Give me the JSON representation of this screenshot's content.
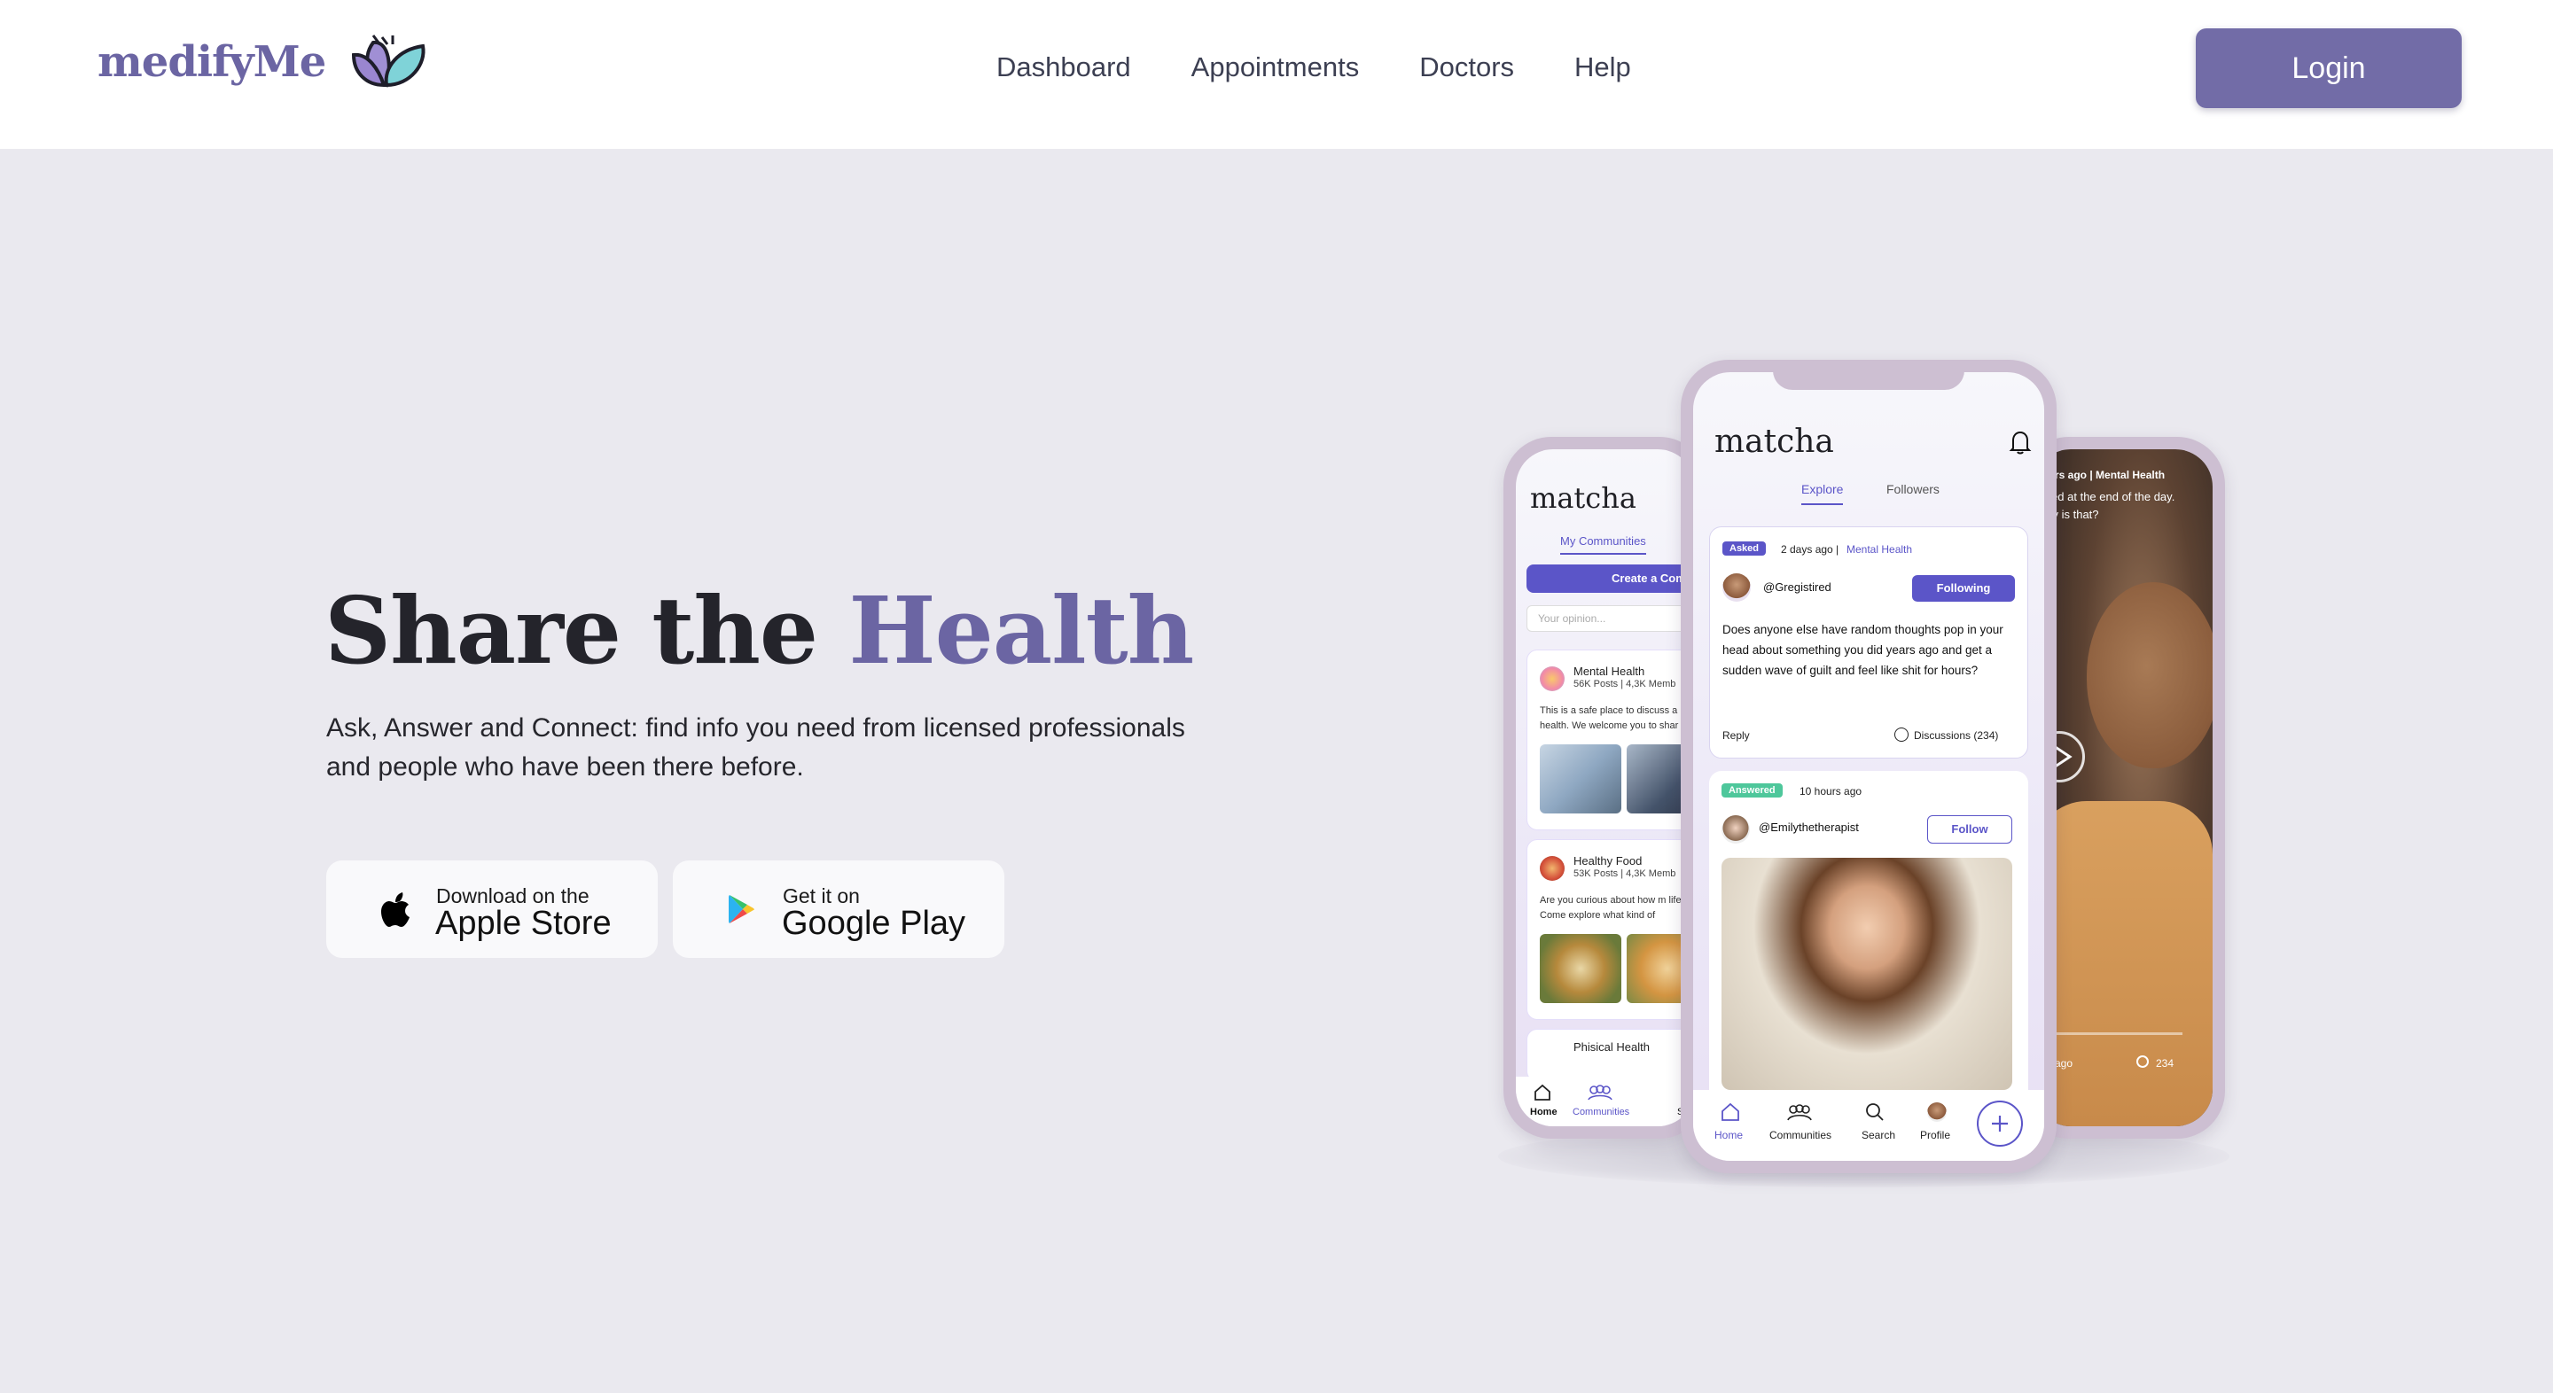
{
  "header": {
    "brand": "medifyMe",
    "nav": [
      "Dashboard",
      "Appointments",
      "Doctors",
      "Help"
    ],
    "login_label": "Login"
  },
  "hero": {
    "title_plain": "Share the ",
    "title_accent": "Health",
    "subtitle": "Ask, Answer and Connect: find info you need from licensed professionals and people who have been there before.",
    "apple": {
      "small": "Download on the",
      "big": "Apple Store",
      "icon": "apple-icon"
    },
    "google": {
      "small": "Get it on",
      "big": "Google Play",
      "icon": "google-play-icon"
    }
  },
  "phone_center": {
    "app_title": "matcha",
    "tabs": [
      "Explore",
      "Followers"
    ],
    "post1": {
      "badge": "Asked",
      "meta": "2 days ago |",
      "topic": "Mental Health",
      "user": "@Gregistired",
      "follow_label": "Following",
      "text": "Does anyone else have random thoughts pop in your head about something you did years ago and get a sudden wave of guilt and feel like shit for hours?",
      "reply": "Reply",
      "discussions": "Discussions (234)"
    },
    "post2": {
      "badge": "Answered",
      "meta": "10 hours ago",
      "user": "@Emilythetherapist",
      "follow_label": "Follow"
    },
    "bottom_nav": [
      "Home",
      "Communities",
      "Search",
      "Profile"
    ]
  },
  "phone_left": {
    "app_title": "matcha",
    "tab": "My Communities",
    "create_label": "Create a Com",
    "search_placeholder": "Your opinion...",
    "community1": {
      "name": "Mental Health",
      "stats": "56K Posts | 4,3K Memb",
      "desc": "This is a safe place to discuss a health. We welcome you to shar"
    },
    "community2": {
      "name": "Healthy Food",
      "stats": "53K Posts | 4,3K Memb",
      "desc": "Are you curious about how m life? Come explore what kind of"
    },
    "community3": {
      "name": "Phisical Health"
    },
    "bottom_nav": [
      "Home",
      "Communities",
      "Se"
    ]
  },
  "phone_right": {
    "meta": "hours ago | Mental Health",
    "caption": "I tired at the end of the day. Why is that?",
    "time": "ays ago",
    "count": "234"
  },
  "colors": {
    "brand": "#6b65a3",
    "accent_blue": "#5b55c8",
    "background": "#eae9ef"
  }
}
